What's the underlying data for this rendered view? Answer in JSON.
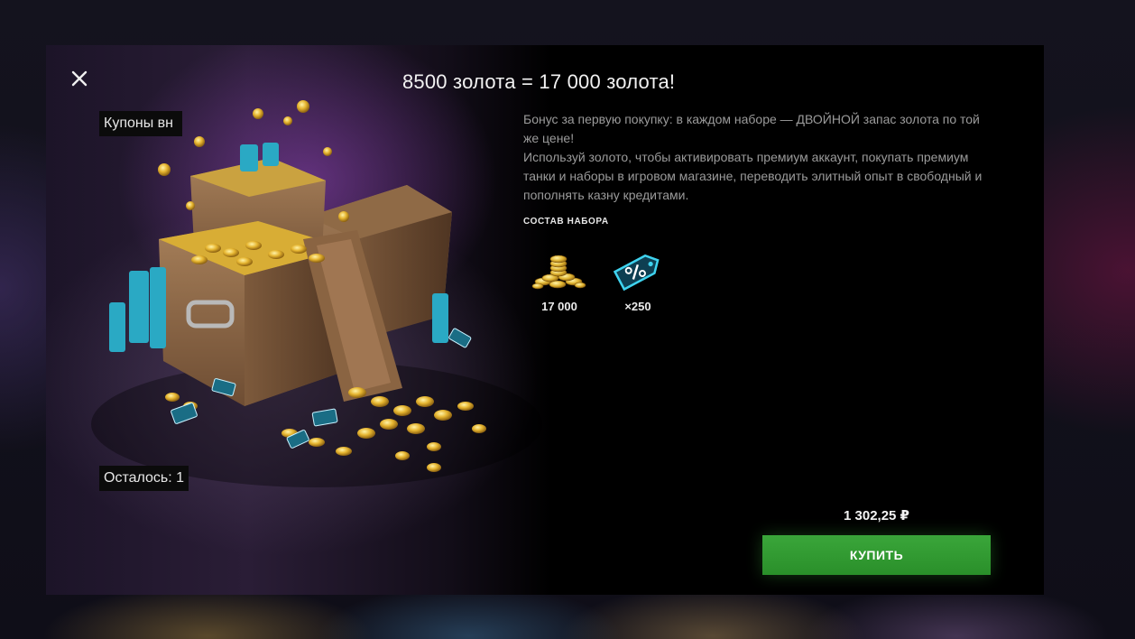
{
  "dialog": {
    "title": "8500 золота = 17 000 золота!",
    "description": [
      "Бонус за первую покупку: в каждом наборе — ДВОЙНОЙ запас золота по той же цене!",
      "Используй золото, чтобы активировать премиум аккаунт, покупать премиум танки и наборы в игровом магазине, переводить элитный опыт в свободный и пополнять казну кредитами."
    ],
    "set_label": "СОСТАВ НАБОРА",
    "items": [
      {
        "icon": "gold-coins-icon",
        "quantity": "17 000"
      },
      {
        "icon": "discount-coupon-icon",
        "quantity": "×250"
      }
    ],
    "art_tags": {
      "coupons": "Купоны вн",
      "remaining": "Осталось: 1"
    },
    "price": "1 302,25 ₽",
    "buy_label": "КУПИТЬ",
    "close_icon": "close-icon"
  },
  "colors": {
    "buy_button": "#2e9a2e",
    "coupon_accent": "#28c4e0",
    "gold": "#e0b431"
  }
}
